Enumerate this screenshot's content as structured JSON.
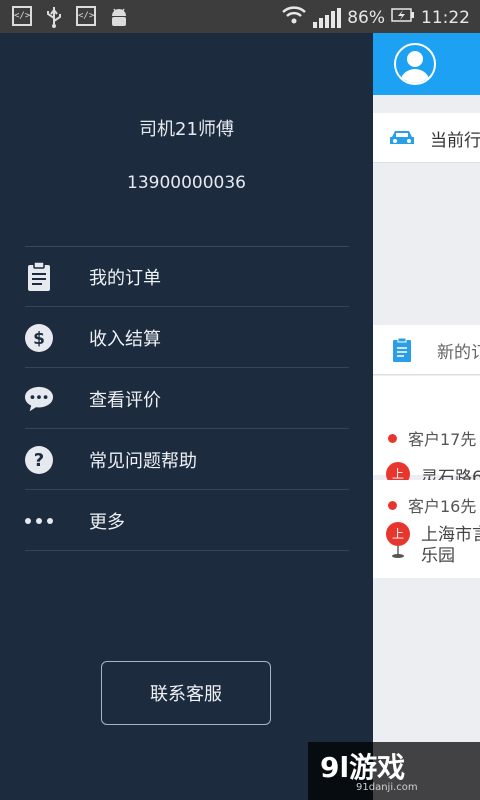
{
  "status_bar": {
    "left_icons": [
      "code-icon",
      "usb-icon",
      "code-icon",
      "android-icon"
    ],
    "battery": "86%",
    "time": "11:22"
  },
  "drawer": {
    "driver_name": "司机21师傅",
    "phone": "13900000036",
    "menu": [
      {
        "label": "我的订单",
        "icon": "clipboard-icon"
      },
      {
        "label": "收入结算",
        "icon": "dollar-icon"
      },
      {
        "label": "查看评价",
        "icon": "chat-bubble-icon"
      },
      {
        "label": "常见问题帮助",
        "icon": "question-icon"
      },
      {
        "label": "更多",
        "icon": "more-dots-icon"
      }
    ],
    "contact_button": "联系客服"
  },
  "main": {
    "current_trip_label": "当前行",
    "new_orders_label": "新的订",
    "orders": [
      {
        "customer": "客户17先",
        "pickup_badge": "上",
        "address": "灵石路6"
      },
      {
        "customer": "客户16先",
        "pickup_badge": "上",
        "address_line1": "上海市言",
        "address_line2": "乐园"
      }
    ]
  },
  "watermark": {
    "logo": "9l游戏",
    "url": "91danji.com"
  },
  "colors": {
    "drawer_bg": "#1c2b3e",
    "header_blue": "#1da1f2",
    "accent_red": "#e8362f"
  }
}
